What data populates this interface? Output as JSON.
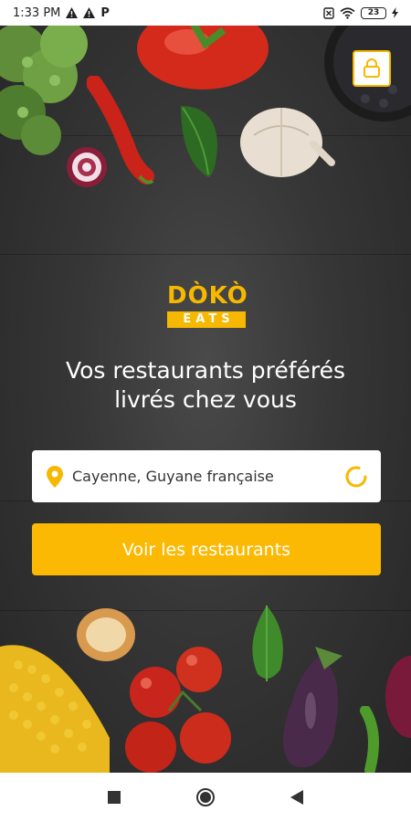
{
  "status_bar": {
    "time": "1:33 PM",
    "left_icons": [
      "warning-icon",
      "warning-icon",
      "parking-icon"
    ],
    "right_icons": [
      "sim-icon",
      "wifi-icon",
      "battery-icon",
      "charging-icon"
    ],
    "battery": "23"
  },
  "brand": {
    "logo_top": "DÒKÒ",
    "logo_bottom": "EATS",
    "accent": "#fbb903"
  },
  "hero": {
    "line1": "Vos restaurants préférés",
    "line2": "livrés chez vous"
  },
  "search": {
    "value": "Cayenne, Guyane française",
    "icon": "location-pin-icon",
    "trailing_icon": "loading-spinner-icon"
  },
  "cta": {
    "label": "Voir les restaurants"
  },
  "header": {
    "account_icon": "lock-icon"
  },
  "nav_bar": {
    "buttons": [
      "recents-icon",
      "home-icon",
      "back-icon"
    ]
  }
}
